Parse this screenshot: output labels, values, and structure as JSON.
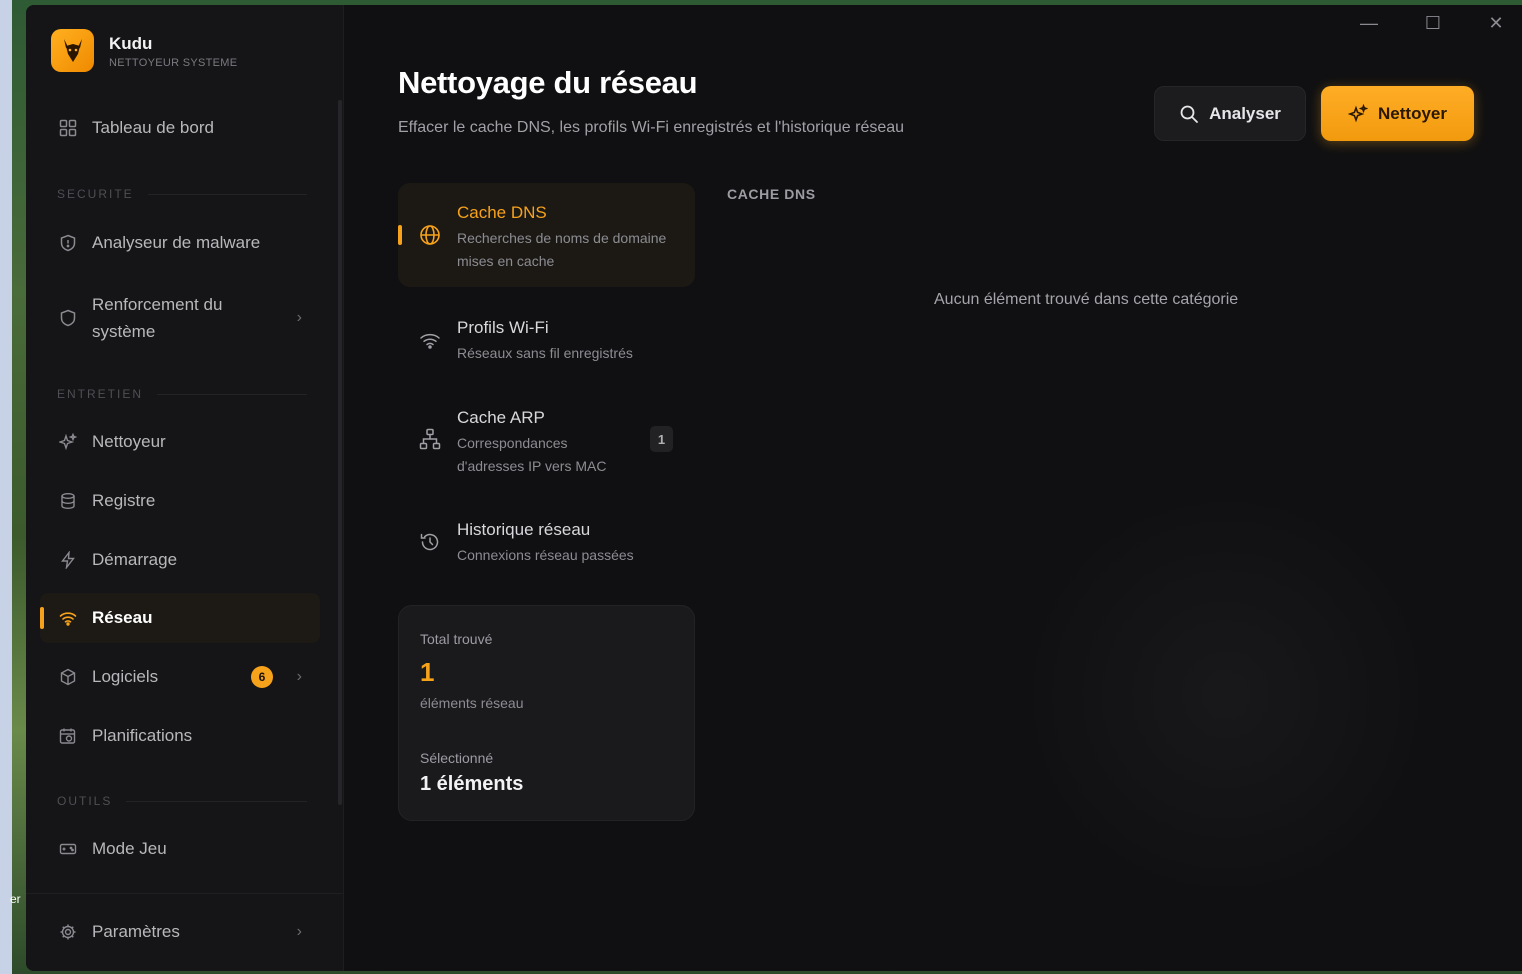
{
  "desktop": {
    "edge_text": "er"
  },
  "app": {
    "name": "Kudu",
    "subtitle": "NETTOYEUR SYSTEME"
  },
  "window_controls": {
    "minimize": "—",
    "maximize": "☐",
    "close": "✕"
  },
  "sidebar": {
    "dashboard": "Tableau de bord",
    "sections": {
      "security": "SECURITE",
      "maintenance": "ENTRETIEN",
      "tools": "OUTILS"
    },
    "items": {
      "malware": "Analyseur de malware",
      "hardening_line1": "Renforcement du",
      "hardening_line2": "système",
      "cleaner": "Nettoyeur",
      "registry": "Registre",
      "startup": "Démarrage",
      "network": "Réseau",
      "software": "Logiciels",
      "software_badge": "6",
      "schedules": "Planifications",
      "game_mode": "Mode Jeu",
      "settings": "Paramètres"
    }
  },
  "header": {
    "title": "Nettoyage du réseau",
    "subtitle": "Effacer le cache DNS, les profils Wi-Fi enregistrés et l'historique réseau",
    "analyze_label": "Analyser",
    "clean_label": "Nettoyer"
  },
  "categories": [
    {
      "title": "Cache DNS",
      "desc1": "Recherches de noms de domaine",
      "desc2": "mises en cache",
      "count": ""
    },
    {
      "title": "Profils Wi-Fi",
      "desc1": "Réseaux sans fil enregistrés",
      "desc2": "",
      "count": ""
    },
    {
      "title": "Cache ARP",
      "desc1": "Correspondances",
      "desc2": "d'adresses IP vers MAC",
      "count": "1"
    },
    {
      "title": "Historique réseau",
      "desc1": "Connexions réseau passées",
      "desc2": "",
      "count": ""
    }
  ],
  "summary": {
    "total_label": "Total trouvé",
    "total_value": "1",
    "total_unit": "éléments réseau",
    "selected_label": "Sélectionné",
    "selected_value": "1 éléments"
  },
  "detail": {
    "heading": "CACHE DNS",
    "empty_message": "Aucun élément trouvé dans cette catégorie"
  },
  "colors": {
    "accent": "#f7a21b",
    "background": "#101012",
    "sidebar": "#151517"
  }
}
